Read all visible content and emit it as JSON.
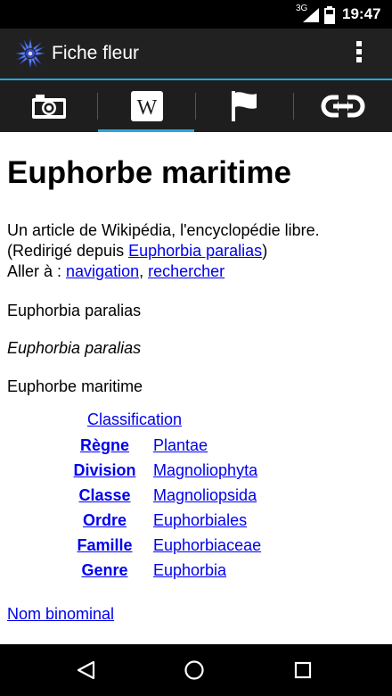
{
  "status": {
    "network": "3G",
    "time": "19:47"
  },
  "appbar": {
    "title": "Fiche fleur",
    "logo_icon": "cornflower-icon",
    "menu_icon": "overflow-menu-icon"
  },
  "tabs": [
    {
      "icon": "camera-icon"
    },
    {
      "icon": "wikipedia-icon",
      "selected": true
    },
    {
      "icon": "flag-icon"
    },
    {
      "icon": "link-icon"
    }
  ],
  "article": {
    "title": "Euphorbe maritime",
    "intro_line": "Un article de Wikipédia, l'encyclopédie libre.",
    "redirect_prefix": "(Redirigé depuis ",
    "redirect_link": "Euphorbia paralias",
    "redirect_suffix": ")",
    "goto_prefix": "Aller à : ",
    "goto_nav": "navigation",
    "goto_sep": ", ",
    "goto_search": "rechercher",
    "para1": "Euphorbia paralias",
    "para2": "Euphorbia paralias",
    "para3": "Euphorbe maritime",
    "classification_header": "Classification",
    "classification": [
      {
        "rank": "Règne",
        "value": "Plantae"
      },
      {
        "rank": "Division",
        "value": "Magnoliophyta"
      },
      {
        "rank": "Classe",
        "value": "Magnoliopsida"
      },
      {
        "rank": "Ordre",
        "value": "Euphorbiales"
      },
      {
        "rank": "Famille",
        "value": "Euphorbiaceae"
      },
      {
        "rank": "Genre",
        "value": "Euphorbia"
      }
    ],
    "binomial_link": "Nom binominal"
  },
  "colors": {
    "accent": "#26a6e0",
    "link": "#0000ee",
    "appbar": "#212121",
    "tabbar": "#1e1e1e"
  },
  "navbar": {
    "back_icon": "back-icon",
    "home_icon": "home-icon",
    "recents_icon": "recents-icon"
  }
}
